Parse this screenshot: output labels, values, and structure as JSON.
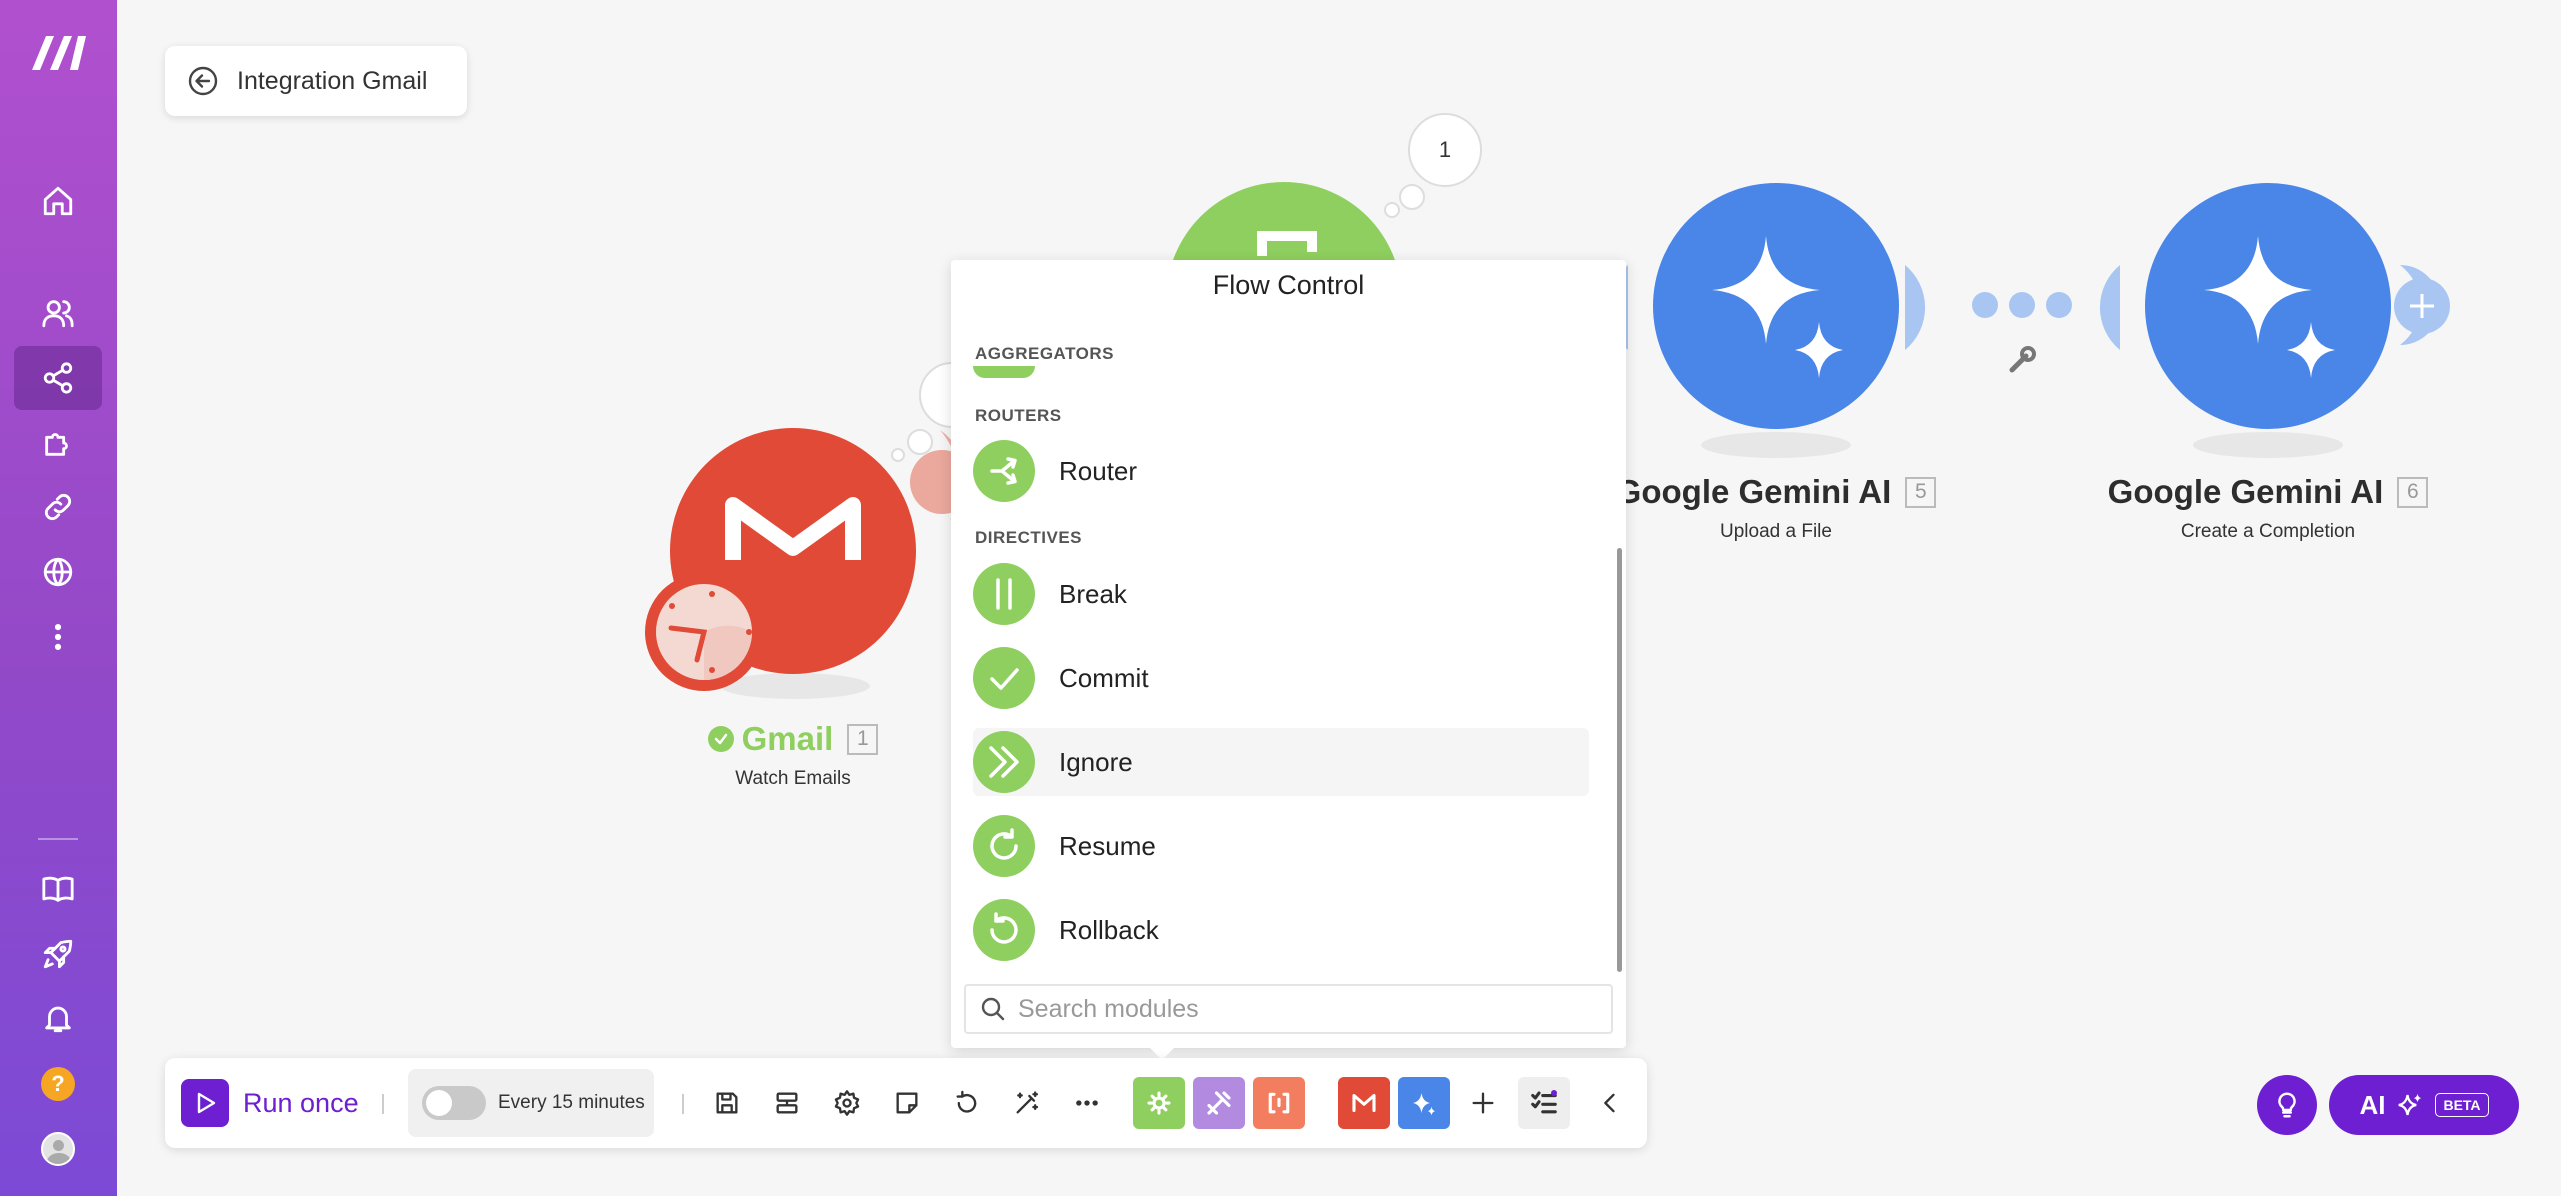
{
  "scenario": {
    "title": "Integration Gmail"
  },
  "nodes": [
    {
      "name": "Gmail",
      "number": "1",
      "subtitle": "Watch Emails"
    },
    {
      "name": "Google Gemini AI",
      "number": "5",
      "subtitle": "Upload a File"
    },
    {
      "name": "Google Gemini AI",
      "number": "6",
      "subtitle": "Create a Completion"
    }
  ],
  "bubble_count": "1",
  "popup": {
    "title": "Flow Control",
    "sections": {
      "aggregators": "AGGREGATORS",
      "routers": "ROUTERS",
      "directives": "DIRECTIVES"
    },
    "items": [
      {
        "label": "Router",
        "icon": "router-icon"
      },
      {
        "label": "Break",
        "icon": "pause-icon"
      },
      {
        "label": "Commit",
        "icon": "check-icon"
      },
      {
        "label": "Ignore",
        "icon": "double-chevron-icon"
      },
      {
        "label": "Resume",
        "icon": "redo-icon"
      },
      {
        "label": "Rollback",
        "icon": "undo-icon"
      }
    ],
    "search_placeholder": "Search modules"
  },
  "toolbar": {
    "run_label": "Run once",
    "schedule_label": "Every 15 minutes"
  },
  "ai": {
    "label": "AI",
    "badge": "BETA"
  },
  "colors": {
    "brand": "#6d1fd1",
    "sidebar": "#9b4fd0",
    "gmail": "#e04a36",
    "gemini": "#4a86e8",
    "flow_control": "#8fcf5f"
  }
}
